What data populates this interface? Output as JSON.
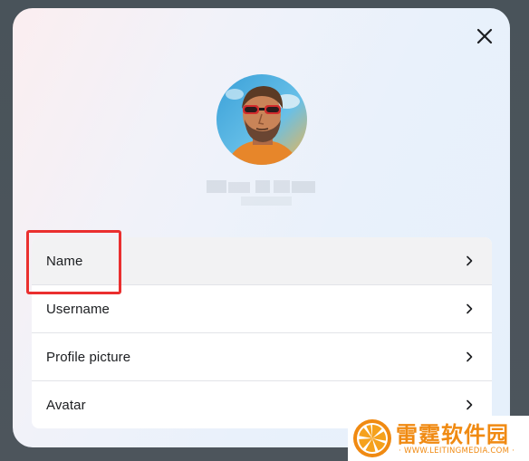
{
  "dialog": {
    "close_icon": "close-icon",
    "avatar_description": "profile-photo"
  },
  "menu": {
    "items": [
      {
        "label": "Name",
        "icon": "chevron-right-icon"
      },
      {
        "label": "Username",
        "icon": "chevron-right-icon"
      },
      {
        "label": "Profile picture",
        "icon": "chevron-right-icon"
      },
      {
        "label": "Avatar",
        "icon": "chevron-right-icon"
      }
    ]
  },
  "annotation": {
    "highlight_color": "#ea2f2f"
  },
  "watermark": {
    "title": "雷霆软件园",
    "url": "· WWW.LEITINGMEDIA.COM ·",
    "color": "#f08a12"
  }
}
